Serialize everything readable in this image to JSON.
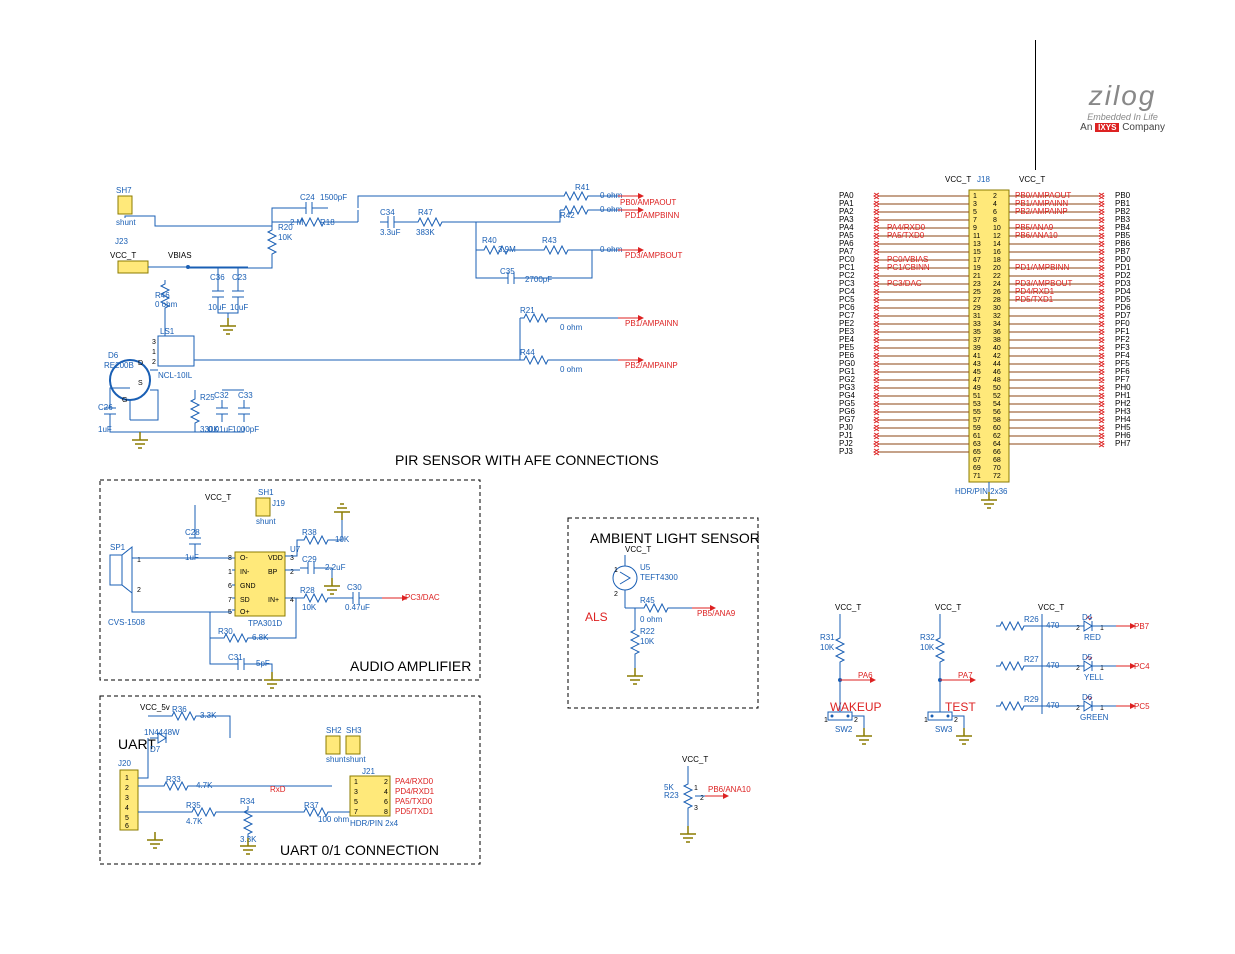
{
  "logo": {
    "brand": "zilog",
    "sub1": "Embedded In Life",
    "sub2_pre": "An",
    "sub2_box": "IXYS",
    "sub2_post": "Company"
  },
  "titles": {
    "pir": "PIR SENSOR WITH AFE CONNECTIONS",
    "als": "AMBIENT LIGHT SENSOR",
    "als_lbl": "ALS",
    "audio": "AUDIO AMPLIFIER",
    "uart": "UART",
    "uart2": "UART 0/1 CONNECTION",
    "wakeup": "WAKEUP",
    "test": "TEST"
  },
  "nets": {
    "vcc_t": "VCC_T",
    "vbias": "VBIAS",
    "vcc5": "VCC_5v",
    "pb0": "PB0/AMPAOUT",
    "pd1": "PD1/AMPBINN",
    "pd3": "PD3/AMPBOUT",
    "pb1": "PB1/AMPAINN",
    "pb2": "PB2/AMPAINP",
    "pc3": "PC3/DAC",
    "pb5": "PB5/ANA9",
    "pb6": "PB6/ANA10",
    "pa4": "PA4/RXD0",
    "pd4": "PD4/RXD1",
    "pa5": "PA5/TXD0",
    "pd5": "PD5/TXD1",
    "rxd": "RxD",
    "pa6": "PA6",
    "pa7": "PA7",
    "pb7": "PB7",
    "pc4": "PC4",
    "pc5": "PC5"
  },
  "comps": {
    "sh7": "SH7",
    "sh1": "SH1",
    "sh2": "SH2",
    "sh3": "SH3",
    "shunt": "shunt",
    "j23": "J23",
    "j18": "J18",
    "j19": "J19",
    "j20": "J20",
    "j21": "J21",
    "c24": "C24",
    "c24v": "1500pF",
    "c34": "C34",
    "c34v": "3.3uF",
    "c35": "C35",
    "c35v": "2700pF",
    "c36": "C36",
    "c36v": "10uF",
    "c23": "C23",
    "c23v": "10uF",
    "c26": "C26",
    "c26v": "1uF",
    "c32": "C32",
    "c32v": "0.01uF",
    "c33": "C33",
    "c33v": "1000pF",
    "c28": "C28",
    "c28v": "1uF",
    "c29": "C29",
    "c29v": "2.2uF",
    "c30": "C30",
    "c30v": "0.47uF",
    "c31": "C31",
    "c31v": "5pF",
    "r20": "R20",
    "r20v": "10K",
    "r18": "R18",
    "r18v": "2 M",
    "r41": "R41",
    "r41v": "0 ohm",
    "r42": "R42",
    "r42v": "0 ohm",
    "r40": "R40",
    "r40v": "3.9M",
    "r43": "R43",
    "r43v": "0 ohm",
    "r47": "R47",
    "r47v": "383K",
    "r46": "R46",
    "r46v": "0 ohm",
    "r25": "R25",
    "r25v": "330K",
    "r21": "R21",
    "r21v": "0 ohm",
    "r44": "R44",
    "r44v": "0 ohm",
    "r38": "R38",
    "r38v": "10K",
    "r28": "R28",
    "r28v": "10K",
    "r30": "R30",
    "r30v": "6.8K",
    "r36": "R36",
    "r36v": "3.3K",
    "r33": "R33",
    "r33v": "4.7K",
    "r35": "R35",
    "r35v": "4.7K",
    "r34": "R34",
    "r34v": "3.3K",
    "r37": "R37",
    "r37v": "100 ohm",
    "r45": "R45",
    "r45v": "0 ohm",
    "r22": "R22",
    "r22v": "10K",
    "r23": "R23",
    "r23v": "5K",
    "r31": "R31",
    "r31v": "10K",
    "r32": "R32",
    "r32v": "10K",
    "r26": "R26",
    "r26v": "470",
    "r27": "R27",
    "r27v": "470",
    "r29": "R29",
    "r29v": "470",
    "d4": "D4",
    "d4v": "RED",
    "d5": "D5",
    "d5v": "YELL",
    "d6": "D6",
    "d6v": "RE200B",
    "d6b": "D6",
    "d6bv": "GREEN",
    "d7": "D7",
    "d7v": "1N4448W",
    "u5": "U5",
    "u5v": "TEFT4300",
    "u7": "U7",
    "u7v": "TPA301D",
    "ls1": "LS1",
    "ls1v": "NCL-10IL",
    "sp1": "SP1",
    "sp1v": "CVS-1508",
    "sw2": "SW2",
    "sw3": "SW3",
    "hdr2x4": "HDR/PIN 2x4",
    "hdr2x36": "HDR/PIN 2x36"
  },
  "header_left": [
    "PA0",
    "PA1",
    "PA2",
    "PA3",
    "PA4",
    "PA5",
    "PA6",
    "PA7",
    "PC0",
    "PC1",
    "PC2",
    "PC3",
    "PC4",
    "PC5",
    "PC6",
    "PC7",
    "PE2",
    "PE3",
    "PE4",
    "PE5",
    "PE6",
    "PG0",
    "PG1",
    "PG2",
    "PG3",
    "PG4",
    "PG5",
    "PG6",
    "PG7",
    "PJ0",
    "PJ1",
    "PJ2",
    "PJ3"
  ],
  "header_right": [
    "PB0",
    "PB1",
    "PB2",
    "PB3",
    "PB4",
    "PB5",
    "PB6",
    "PB7",
    "PD0",
    "PD1",
    "PD2",
    "PD3",
    "PD4",
    "PD5",
    "PD6",
    "PD7",
    "PF0",
    "PF1",
    "PF2",
    "PF3",
    "PF4",
    "PF5",
    "PF6",
    "PF7",
    "PH0",
    "PH1",
    "PH2",
    "PH3",
    "PH4",
    "PH5",
    "PH6",
    "PH7"
  ],
  "header_tnets_l": {
    "4": "PA4/RXD0",
    "5": "PA5/TXD0",
    "8": "PC0/VBIAS",
    "9": "PC1/CBINN",
    "11": "PC3/DAC"
  },
  "header_tnets_r": {
    "0": "PB0/AMPAOUT",
    "1": "PB1/AMPAINN",
    "2": "PB2/AMPAINP",
    "4": "PB5/ANA9",
    "5": "PB6/ANA10",
    "9": "PD1/AMPBINN",
    "11": "PD3/AMPBOUT",
    "12": "PD4/RXD1",
    "13": "PD5/TXD1"
  },
  "u7_pins": {
    "1": "IN-",
    "2": "BP",
    "3": "VDD",
    "4": "IN+",
    "5": "O+",
    "6": "GND",
    "7": "SD",
    "8": "O-"
  }
}
